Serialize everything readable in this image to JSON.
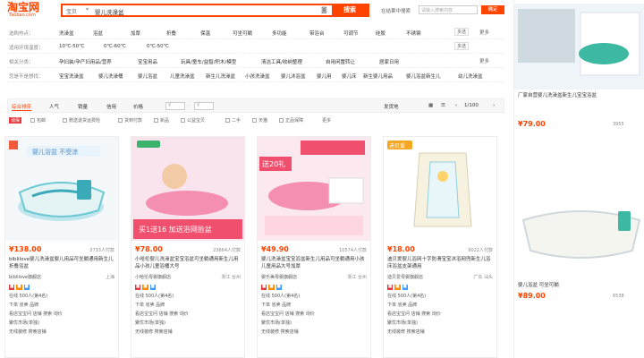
{
  "header": {
    "logo": "淘宝网",
    "logo_sub": "Taobao.com",
    "category": "宝贝",
    "query": "婴儿洗澡盆",
    "search_button": "搜索",
    "shop_search_label": "在结果中搜索",
    "shop_search_placeholder": "请输入搜索内容",
    "shop_search_button": "确定"
  },
  "filters": [
    {
      "label": "选购热点：",
      "items": [
        "洗澡盆",
        "浴盆",
        "加厚",
        "折叠",
        "保温",
        "可坐可躺",
        "多功能",
        "带浴台",
        "可调节",
        "硅胶",
        "不锈钢"
      ],
      "multi": "多选",
      "more": "更多"
    },
    {
      "label": "适用环境温度：",
      "items": [
        "10℃-50℃",
        "0℃-60℃",
        "0℃-50℃"
      ],
      "multi": "多选",
      "more": ""
    },
    {
      "label": "相关分类：",
      "items": [
        "孕妇装/孕产妇用品/营养",
        "宝宝用品",
        "玩具/童车/益智/积木/模型",
        "清洁工具/收纳整理",
        "自用闲置转让",
        "居家日用"
      ],
      "multi": "",
      "more": "更多"
    },
    {
      "label": "您是不是想找：",
      "items": [
        "宝宝洗澡盆",
        "婴儿洗澡桶",
        "婴儿浴盆",
        "儿童洗澡盆",
        "新生儿洗澡盆",
        "小孩洗澡盆",
        "婴儿沐浴盆",
        "婴儿用",
        "婴儿床",
        "新生婴儿用品",
        "婴儿浴盆新生儿",
        "幼儿洗澡盆"
      ],
      "multi": "",
      "more": ""
    }
  ],
  "sort": {
    "items": [
      "综合排序",
      "人气",
      "销量",
      "信用",
      "价格"
    ],
    "price_from": "¥",
    "price_to": "¥",
    "ship_from": "发货地",
    "page": "1/100"
  },
  "options": [
    "包邮",
    "赠送退货运费险",
    "货到付款",
    "新品",
    "公益宝贝",
    "二手",
    "天猫",
    "正品保障",
    "更多"
  ],
  "options_prefix": "消保",
  "cards": [
    {
      "price": "¥138.00",
      "sales": "3733人付款",
      "title": "biblilove婴儿洗澡盆婴儿用品可坐躺通用新生儿折叠浴盆",
      "shop": "biblilove旗舰店",
      "loc": "上海",
      "badge_banner": "婴儿浴盆 不受凉"
    },
    {
      "price": "¥78.00",
      "sales": "23664人付款",
      "title": "小哈伦婴儿洗澡盆宝宝浴盆可坐躺通用新生儿用品小孩儿童浴桶大号",
      "shop": "小哈伦母婴旗舰店",
      "loc": "浙江 台州",
      "badge_banner": "买1送16 加送浴网脸盆"
    },
    {
      "price": "¥49.90",
      "sales": "10574人付款",
      "title": "婴儿洗澡盆宝宝浴盆新生儿用品可坐躺通用小孩儿童用品大号加厚",
      "shop": "婴乐美母婴旗舰店",
      "loc": "浙江 台州",
      "badge_banner": "送20礼"
    },
    {
      "price": "¥18.00",
      "sales": "9022人付款",
      "title": "迪贝爱婴儿浴网十字防滑宝宝沐浴网兜新生儿浴床浴盆支架通用",
      "shop": "迪贝爱母婴旗舰店",
      "loc": "广东 汕头",
      "badge_banner": "迪贝爱"
    }
  ],
  "card_services": [
    "在线 500人(第4名)",
    "下单 省卖 品牌",
    "看店宝宝问 店铺 搜索 询价",
    "聚优市场(单独)",
    "无线装修 搜索店铺"
  ],
  "right_cards": [
    {
      "title": "厂家自营婴儿洗澡盆新生儿宝宝浴盆",
      "price": "¥79.00",
      "sales": "3955"
    },
    {
      "title": "婴儿浴盆 可坐可躺",
      "price": "¥89.00",
      "sales": "6538"
    }
  ],
  "colors": {
    "accent": "#ff4400"
  }
}
